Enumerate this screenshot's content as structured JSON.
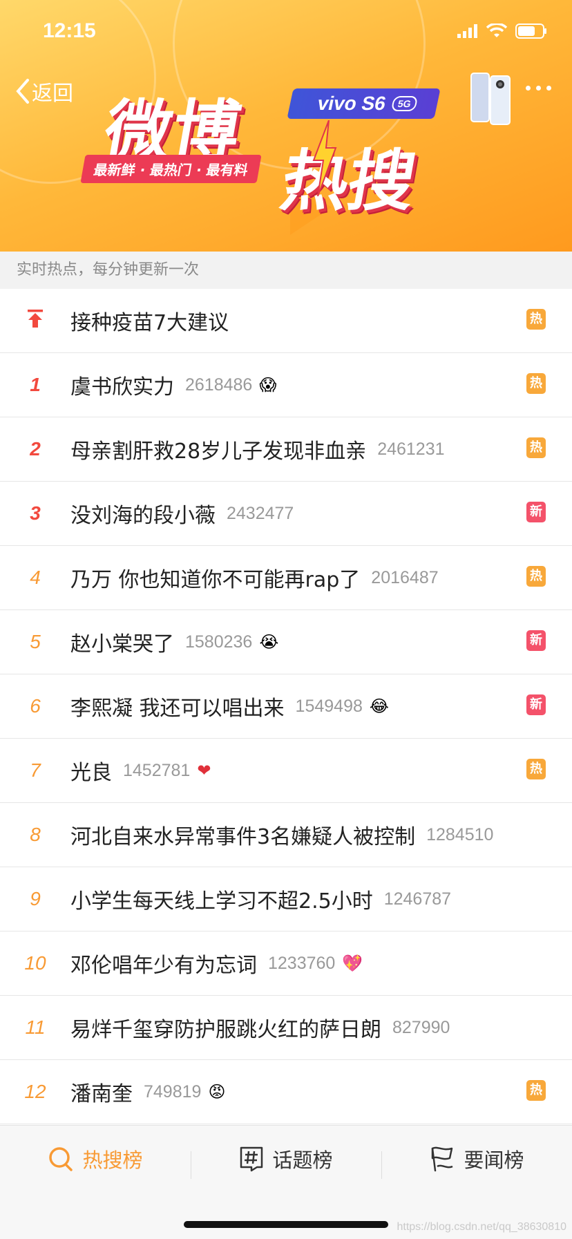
{
  "status_bar": {
    "time": "12:15"
  },
  "nav": {
    "back_label": "返回"
  },
  "banner": {
    "title_main": "微博",
    "title_sub": "热搜",
    "slogan": "最新鲜 · 最热门 · 最有料",
    "ad_brand": "vivo S6",
    "ad_tag": "5G"
  },
  "subheader": {
    "text": "实时热点，每分钟更新一次"
  },
  "rows": [
    {
      "rank": "",
      "topic": "接种疫苗7大建议",
      "count": "",
      "emoji": "",
      "badge": "热",
      "badge_type": "hot",
      "pinned": true
    },
    {
      "rank": "1",
      "topic": "虞书欣实力",
      "count": "2618486",
      "emoji": "😱",
      "badge": "热",
      "badge_type": "hot"
    },
    {
      "rank": "2",
      "topic": "母亲割肝救28岁儿子发现非血亲",
      "count": "2461231",
      "emoji": "",
      "badge": "热",
      "badge_type": "hot"
    },
    {
      "rank": "3",
      "topic": "没刘海的段小薇",
      "count": "2432477",
      "emoji": "",
      "badge": "新",
      "badge_type": "new"
    },
    {
      "rank": "4",
      "topic": "乃万 你也知道你不可能再rap了",
      "count": "2016487",
      "emoji": "",
      "badge": "热",
      "badge_type": "hot"
    },
    {
      "rank": "5",
      "topic": "赵小棠哭了",
      "count": "1580236",
      "emoji": "😭",
      "badge": "新",
      "badge_type": "new"
    },
    {
      "rank": "6",
      "topic": "李熙凝 我还可以唱出来",
      "count": "1549498",
      "emoji": "😂",
      "badge": "新",
      "badge_type": "new"
    },
    {
      "rank": "7",
      "topic": "光良",
      "count": "1452781",
      "emoji": "❤",
      "badge": "热",
      "badge_type": "hot"
    },
    {
      "rank": "8",
      "topic": "河北自来水异常事件3名嫌疑人被控制",
      "count": "1284510",
      "emoji": "",
      "badge": "",
      "badge_type": ""
    },
    {
      "rank": "9",
      "topic": "小学生每天线上学习不超2.5小时",
      "count": "1246787",
      "emoji": "",
      "badge": "",
      "badge_type": ""
    },
    {
      "rank": "10",
      "topic": "邓伦唱年少有为忘词",
      "count": "1233760",
      "emoji": "💖",
      "badge": "",
      "badge_type": ""
    },
    {
      "rank": "11",
      "topic": "易烊千玺穿防护服跳火红的萨日朗",
      "count": "827990",
      "emoji": "",
      "badge": "",
      "badge_type": ""
    },
    {
      "rank": "12",
      "topic": "潘南奎",
      "count": "749819",
      "emoji": "😡",
      "badge": "热",
      "badge_type": "hot"
    }
  ],
  "tabs": [
    {
      "label": "热搜榜",
      "icon": "search-rank-icon",
      "active": true
    },
    {
      "label": "话题榜",
      "icon": "hashtag-icon",
      "active": false
    },
    {
      "label": "要闻榜",
      "icon": "news-flag-icon",
      "active": false
    }
  ],
  "watermark": "https://blog.csdn.net/qq_38630810",
  "colors": {
    "rank_top3": "#f2493e",
    "rank_other": "#f89a34",
    "badge_hot": "#f8a83a",
    "badge_new": "#f4526a",
    "tab_active": "#f89a34"
  }
}
